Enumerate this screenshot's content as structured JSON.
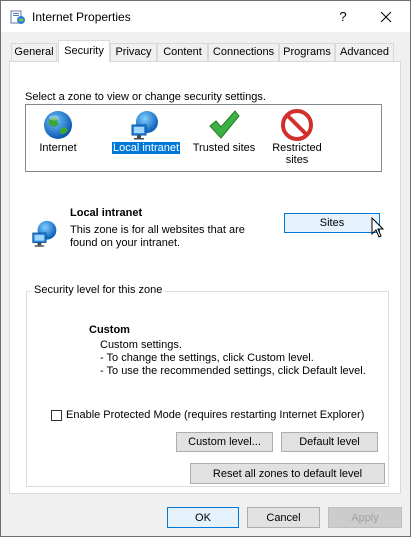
{
  "window": {
    "title": "Internet Properties",
    "help_glyph": "?",
    "close_glyph": "✕"
  },
  "tabs": [
    {
      "label": "General",
      "active": false
    },
    {
      "label": "Security",
      "active": true
    },
    {
      "label": "Privacy",
      "active": false
    },
    {
      "label": "Content",
      "active": false
    },
    {
      "label": "Connections",
      "active": false
    },
    {
      "label": "Programs",
      "active": false
    },
    {
      "label": "Advanced",
      "active": false
    }
  ],
  "security": {
    "zone_prompt": "Select a zone to view or change security settings.",
    "zones": [
      {
        "label": "Internet",
        "icon": "globe-icon",
        "selected": false
      },
      {
        "label": "Local intranet",
        "icon": "intranet-globe-icon",
        "selected": true
      },
      {
        "label": "Trusted sites",
        "icon": "checkmark-icon",
        "selected": false
      },
      {
        "label": "Restricted sites",
        "icon": "no-entry-icon",
        "selected": false
      }
    ],
    "zone_info": {
      "title": "Local intranet",
      "description_line1": "This zone is for all websites that are",
      "description_line2": "found on your intranet."
    },
    "sites_button": "Sites",
    "level_group_label": "Security level for this zone",
    "custom": {
      "title": "Custom",
      "line1": "Custom settings.",
      "line2": "- To change the settings, click Custom level.",
      "line3": "- To use the recommended settings, click Default level."
    },
    "protected_mode": {
      "label": "Enable Protected Mode (requires restarting Internet Explorer)",
      "checked": false
    },
    "custom_level_button": "Custom level...",
    "default_level_button": "Default level",
    "reset_all_button": "Reset all zones to default level"
  },
  "footer": {
    "ok": "OK",
    "cancel": "Cancel",
    "apply": "Apply"
  },
  "colors": {
    "selection": "#0078d7",
    "window_bg": "#f0f0f0",
    "panel_bg": "#ffffff"
  }
}
